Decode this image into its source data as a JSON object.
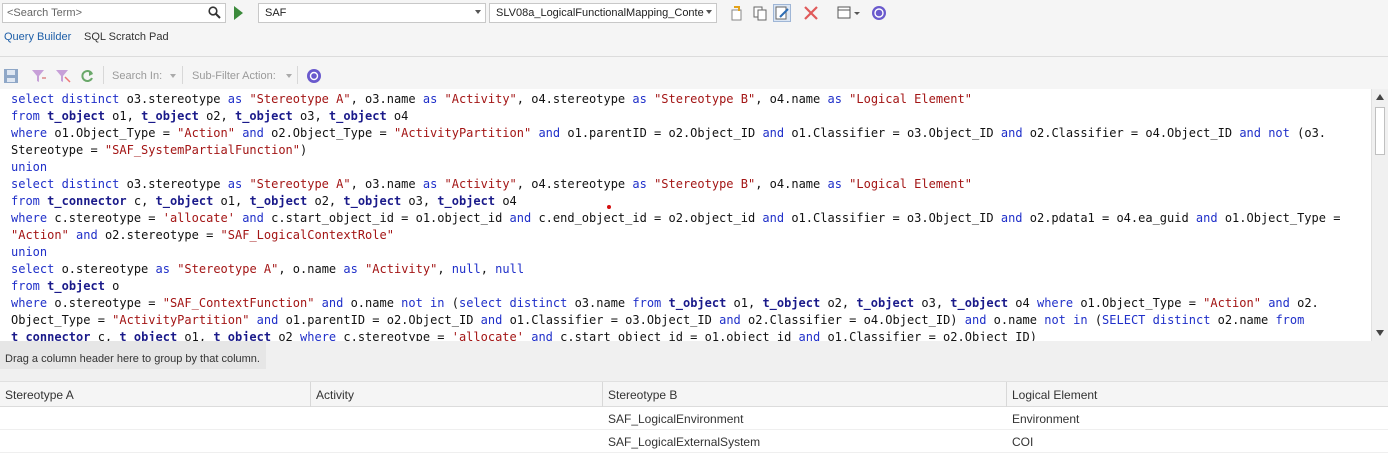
{
  "toolbar": {
    "search_placeholder": "<Search Term>",
    "package_combo": "SAF",
    "query_combo": "SLV08a_LogicalFunctionalMapping_Conte"
  },
  "tabs": [
    {
      "label": "Query Builder"
    },
    {
      "label": "SQL Scratch Pad"
    }
  ],
  "toolbar2": {
    "search_in_label": "Search In:",
    "subfilter_label": "Sub-Filter Action:"
  },
  "group_hint": "Drag a column header here to group by that column.",
  "grid": {
    "columns": [
      "Stereotype A",
      "Activity",
      "Stereotype B",
      "Logical Element"
    ],
    "rows": [
      [
        "",
        "",
        "SAF_LogicalEnvironment",
        "Environment"
      ],
      [
        "",
        "",
        "SAF_LogicalExternalSystem",
        "COI"
      ]
    ]
  },
  "colors": {
    "keyword": "#1f2fc9",
    "string": "#a31515",
    "table": "#1a1a8a",
    "accent": "#1e5fa8"
  }
}
